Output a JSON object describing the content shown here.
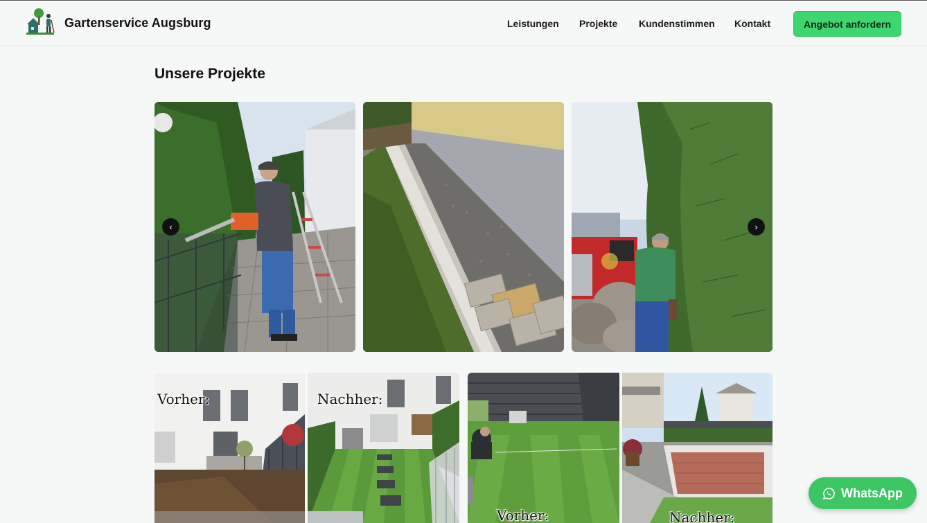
{
  "header": {
    "brand": "Gartenservice Augsburg",
    "logo_icon": "gardener-house-logo",
    "nav": [
      "Leistungen",
      "Projekte",
      "Kundenstimmen",
      "Kontakt"
    ],
    "cta": "Angebot anfordern"
  },
  "projects": {
    "title": "Unsere Projekte",
    "prev_icon": "chevron-left-icon",
    "next_icon": "chevron-right-icon",
    "prev_glyph": "‹",
    "next_glyph": "›",
    "before_label": "Vorher:",
    "after_label": "Nachher:"
  },
  "whatsapp": {
    "label": "WhatsApp",
    "icon": "whatsapp-icon"
  },
  "colors": {
    "accent": "#3ed66f",
    "whatsapp": "#3cc664",
    "background": "#f6f8f7"
  }
}
